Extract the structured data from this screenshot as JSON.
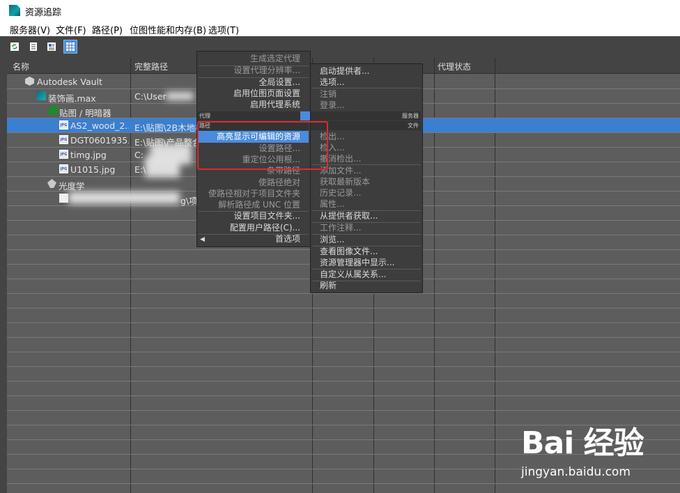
{
  "window": {
    "title": "资源追踪"
  },
  "menubar": {
    "items": [
      "服务器(V)",
      "文件(F)",
      "路径(P)",
      "位图性能和内存(B)",
      "选项(T)"
    ]
  },
  "toolbar": {
    "buttons": [
      "refresh-icon",
      "list-icon",
      "thumbnail-icon",
      "table-view-icon"
    ]
  },
  "table": {
    "columns": [
      "名称",
      "完整路径",
      "代理状态"
    ],
    "rows": [
      {
        "name": "Autodesk Vault",
        "path": "",
        "icon": "vault-icon"
      },
      {
        "name": "装饰画.max",
        "path": "C:\\User",
        "icon": "max-file-icon"
      },
      {
        "name": "贴图 / 明暗器",
        "path": "",
        "icon": "maps-icon"
      },
      {
        "name": "AS2_wood_2...",
        "path": "E:\\贴图\\2B木地板",
        "icon": "jpg-icon"
      },
      {
        "name": "DGT0601935...",
        "path": "E:\\贴图\\产品整合",
        "icon": "jpg-icon"
      },
      {
        "name": "timg.jpg",
        "path": "C:",
        "icon": "jpg-icon"
      },
      {
        "name": "U1015.jpg",
        "path": "E:\\",
        "icon": "jpg-icon"
      },
      {
        "name": "光度学",
        "path": "",
        "icon": "photometric-icon"
      },
      {
        "name": "",
        "path": "g\\项",
        "icon": "document-icon"
      }
    ]
  },
  "path_menu": {
    "items": [
      {
        "label": "生成选定代理",
        "enabled": false
      },
      {
        "label": "设置代理分辨率...",
        "enabled": false
      },
      {
        "label": "全局设置...",
        "enabled": true
      },
      {
        "label": "启用位图页面设置",
        "enabled": true
      },
      {
        "label": "启用代理系统",
        "enabled": true
      }
    ],
    "section_proxy": "代理",
    "section_path": "路径",
    "path_items": [
      {
        "label": "高亮显示可编辑的资源",
        "enabled": true,
        "highlighted": true
      },
      {
        "label": "设置路径...",
        "enabled": false
      },
      {
        "label": "重定位公用根...",
        "enabled": false
      },
      {
        "label": "条带路径",
        "enabled": false
      },
      {
        "label": "使路径绝对",
        "enabled": false
      },
      {
        "label": "使路径相对于项目文件夹",
        "enabled": false
      },
      {
        "label": "解析路径成 UNC 位置",
        "enabled": false
      },
      {
        "label": "设置项目文件夹...",
        "enabled": true
      },
      {
        "label": "配置用户路径(C)...",
        "enabled": true
      }
    ],
    "options_label": "首选项"
  },
  "file_menu": {
    "server_items": [
      {
        "label": "启动提供者...",
        "enabled": true
      },
      {
        "label": "选项...",
        "enabled": true
      },
      {
        "label": "注销",
        "enabled": false
      },
      {
        "label": "登录...",
        "enabled": false
      }
    ],
    "section_server": "服务器",
    "section_file": "文件",
    "file_items": [
      {
        "label": "检出...",
        "enabled": false
      },
      {
        "label": "检入...",
        "enabled": false
      },
      {
        "label": "撤消检出...",
        "enabled": false
      },
      {
        "label": "添加文件...",
        "enabled": false
      },
      {
        "label": "获取最新版本",
        "enabled": false
      },
      {
        "label": "历史记录...",
        "enabled": false
      },
      {
        "label": "属性...",
        "enabled": false
      },
      {
        "label": "从提供者获取...",
        "enabled": true
      },
      {
        "label": "工作注释...",
        "enabled": false
      },
      {
        "label": "浏览...",
        "enabled": true
      },
      {
        "label": "查看图像文件...",
        "enabled": true
      },
      {
        "label": "资源管理器中显示...",
        "enabled": true
      },
      {
        "label": "自定义从属关系...",
        "enabled": true
      },
      {
        "label": "刷新",
        "enabled": true
      }
    ]
  },
  "watermark": {
    "logo": "Bai 经验",
    "site": "jingyan.baidu.com"
  }
}
